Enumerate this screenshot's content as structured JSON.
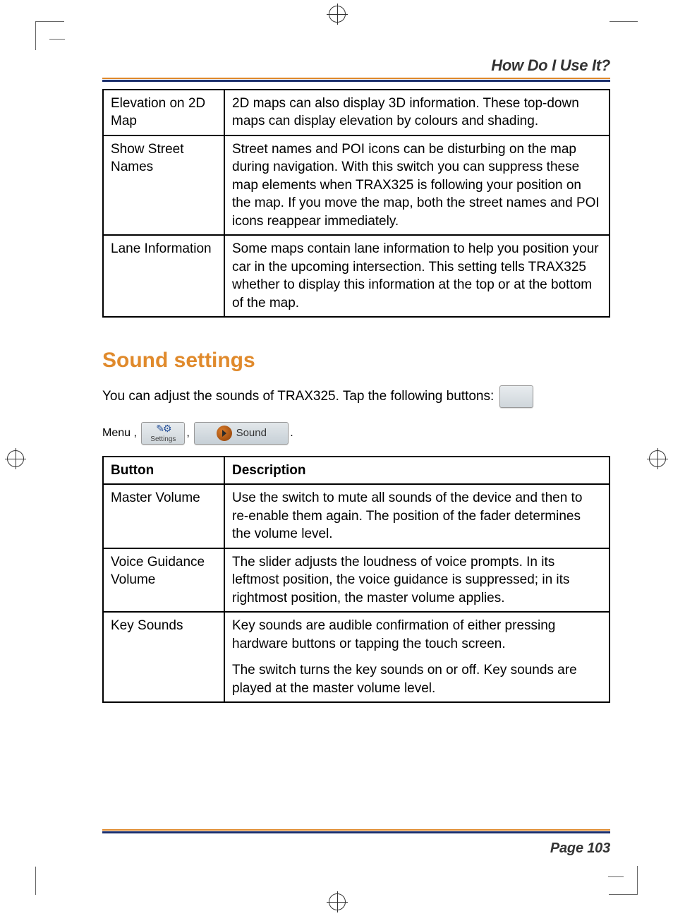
{
  "header": {
    "title": "How Do I Use It?"
  },
  "footer": {
    "page_label": "Page 103"
  },
  "tables": {
    "map_settings": {
      "rows": [
        {
          "button": "Elevation on 2D Map",
          "description": "2D maps can also display 3D information. These top-down maps can display elevation by colours and shading."
        },
        {
          "button": "Show Street Names",
          "description": "Street names and POI icons can be disturbing on the map during navigation. With this switch you can suppress these map elements when TRAX325 is following your position on the map. If you move the map, both the street names and POI icons reappear immediately."
        },
        {
          "button": "Lane Information",
          "description": "Some maps contain lane information to help you position your car in the upcoming intersection. This setting tells TRAX325 whether to display this information at the top or at the bottom of the map."
        }
      ]
    },
    "sound_settings": {
      "header": {
        "col1": "Button",
        "col2": "Description"
      },
      "rows": [
        {
          "button": "Master Volume",
          "desc": [
            "Use the switch to mute all sounds of the device and then to re-enable them again. The position of the fader determines the volume level."
          ]
        },
        {
          "button": "Voice Guidance Volume",
          "desc": [
            "The slider adjusts the loudness of voice prompts. In its leftmost position, the voice guidance is suppressed; in its rightmost position, the master volume applies."
          ]
        },
        {
          "button": "Key Sounds",
          "desc": [
            "Key sounds are audible confirmation of either pressing hardware buttons or tapping the touch screen.",
            "The switch turns the key sounds on or off. Key sounds are played at the master volume level."
          ]
        }
      ]
    }
  },
  "section": {
    "heading": "Sound settings",
    "intro_prefix": "You can adjust the sounds of TRAX325. Tap the following buttons: ",
    "icons": {
      "menu_label": "Menu",
      "settings_label": "Settings",
      "sound_label": "Sound"
    }
  }
}
